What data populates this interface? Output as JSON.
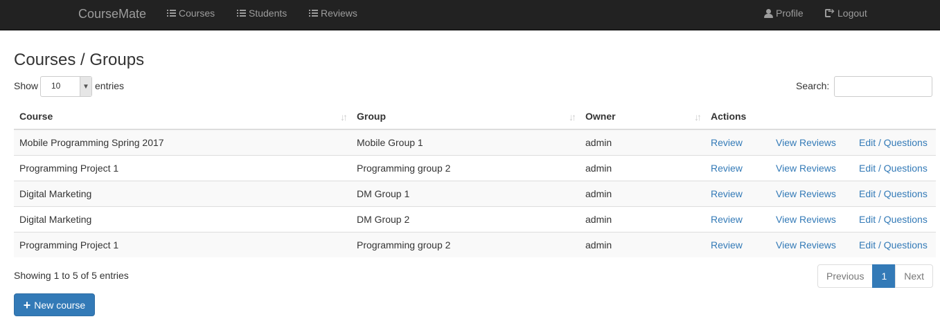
{
  "nav": {
    "brand": "CourseMate",
    "courses": "Courses",
    "students": "Students",
    "reviews": "Reviews",
    "profile": "Profile",
    "logout": "Logout"
  },
  "page": {
    "title": "Courses / Groups",
    "show_label": "Show",
    "page_size": "10",
    "entries_label": "entries",
    "search_label": "Search:",
    "search_value": ""
  },
  "table": {
    "headers": [
      "Course",
      "Group",
      "Owner",
      "Actions"
    ],
    "rows": [
      {
        "course": "Mobile Programming Spring 2017",
        "group": "Mobile Group 1",
        "owner": "admin",
        "review": "Review",
        "view": "View Reviews",
        "edit": "Edit / Questions"
      },
      {
        "course": "Programming Project 1",
        "group": "Programming group 2",
        "owner": "admin",
        "review": "Review",
        "view": "View Reviews",
        "edit": "Edit / Questions"
      },
      {
        "course": "Digital Marketing",
        "group": "DM Group 1",
        "owner": "admin",
        "review": "Review",
        "view": "View Reviews",
        "edit": "Edit / Questions"
      },
      {
        "course": "Digital Marketing",
        "group": "DM Group 2",
        "owner": "admin",
        "review": "Review",
        "view": "View Reviews",
        "edit": "Edit / Questions"
      },
      {
        "course": "Programming Project 1",
        "group": "Programming group 2",
        "owner": "admin",
        "review": "Review",
        "view": "View Reviews",
        "edit": "Edit / Questions"
      }
    ]
  },
  "footer": {
    "info": "Showing 1 to 5 of 5 entries",
    "previous": "Previous",
    "current_page": "1",
    "next": "Next",
    "new_course": "New course"
  },
  "colors": {
    "navbar_bg": "#222222",
    "link": "#337ab7",
    "primary": "#337ab7"
  }
}
